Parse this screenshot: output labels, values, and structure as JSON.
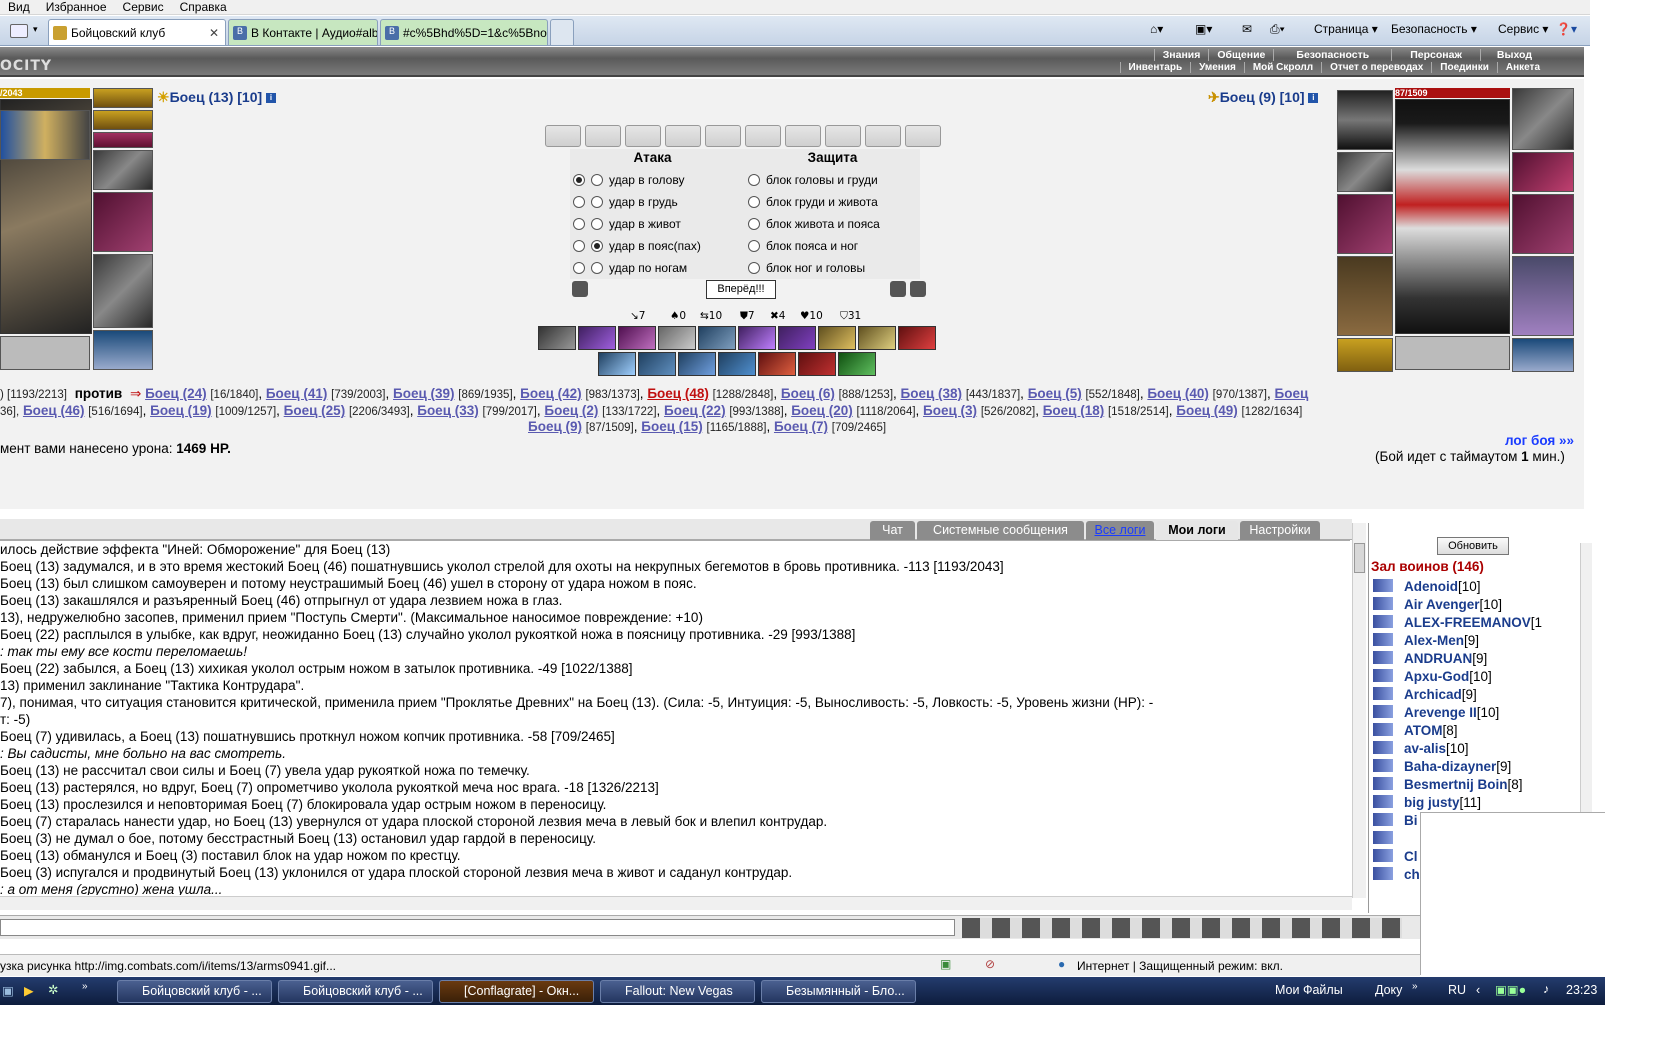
{
  "menubar": {
    "items": [
      "Вид",
      "Избранное",
      "Сервис",
      "Справка"
    ]
  },
  "browser_tabs": [
    {
      "label": "Бойцовский клуб",
      "active": true
    },
    {
      "label": "В Контакте | Аудио#albu...",
      "active": false
    },
    {
      "label": "#c%5Bhd%5D=1&c%5Bno...",
      "active": false
    }
  ],
  "toolbar": {
    "page": "Страница ▾",
    "security": "Безопасность ▾",
    "service": "Сервис ▾"
  },
  "game": {
    "logo": "OCITY",
    "nav_top": [
      "Знания",
      "Общение",
      "Безопасность",
      "Персонаж",
      "Выход"
    ],
    "nav_bottom": [
      "Инвентарь",
      "Умения",
      "Мой Скролл",
      "Отчет о переводах",
      "Поединки",
      "Анкета"
    ]
  },
  "player": {
    "name": "Боец (13) [10]",
    "hp": "/2043"
  },
  "opponent": {
    "name": "Боец (9) [10]",
    "hp": "87/1509"
  },
  "attack": {
    "header": "Атака",
    "options": [
      "удар в голову",
      "удар в грудь",
      "удар в живот",
      "удар в пояс(пах)",
      "удар по ногам"
    ]
  },
  "defense": {
    "header": "Защита",
    "options": [
      "блок головы и груди",
      "блок груди и живота",
      "блок живота и пояса",
      "блок пояса и ног",
      "блок ног и головы"
    ]
  },
  "go_button": "Вперёд!!!",
  "stats": [
    "↘7",
    "♠0",
    "⇆10",
    "⛊7",
    "✖4",
    "♥10",
    "⛉31"
  ],
  "battle": {
    "line1_prefix": ") [1193/2213]",
    "versus": "против",
    "line1": [
      {
        "n": "Боец (24)",
        "v": "[16/1840]"
      },
      {
        "n": "Боец (41)",
        "v": "[739/2003]"
      },
      {
        "n": "Боец (39)",
        "v": "[869/1935]"
      },
      {
        "n": "Боец (42)",
        "v": "[983/1373]"
      },
      {
        "n": "Боец (48)",
        "v": "[1288/2848]"
      },
      {
        "n": "Боец (6)",
        "v": "[888/1253]"
      },
      {
        "n": "Боец (38)",
        "v": "[443/1837]"
      },
      {
        "n": "Боец (5)",
        "v": "[552/1848]"
      },
      {
        "n": "Боец (40)",
        "v": "[970/1387]"
      },
      {
        "n": "Боец",
        "v": ""
      }
    ],
    "line2_prefix": "36],",
    "line2": [
      {
        "n": "Боец (46)",
        "v": "[516/1694]"
      },
      {
        "n": "Боец (19)",
        "v": "[1009/1257]"
      },
      {
        "n": "Боец (25)",
        "v": "[2206/3493]"
      },
      {
        "n": "Боец (33)",
        "v": "[799/2017]"
      },
      {
        "n": "Боец (2)",
        "v": "[133/1722]"
      },
      {
        "n": "Боец (22)",
        "v": "[993/1388]"
      },
      {
        "n": "Боец (20)",
        "v": "[1118/2064]"
      },
      {
        "n": "Боец (3)",
        "v": "[526/2082]"
      },
      {
        "n": "Боец (18)",
        "v": "[1518/2514]"
      },
      {
        "n": "Боец (49)",
        "v": "[1282/1634]"
      }
    ],
    "line3": [
      {
        "n": "Боец (9)",
        "v": "[87/1509]"
      },
      {
        "n": "Боец (15)",
        "v": "[1165/1888]"
      },
      {
        "n": "Боец (7)",
        "v": "[709/2465]"
      }
    ],
    "damage_text": "мент вами нанесено урона:",
    "damage_value": "1469 HP.",
    "log_link": "лог боя »»",
    "timeout": "(Бой идет с таймаутом",
    "timeout_val": "1",
    "timeout_unit": "мин.)"
  },
  "log_tabs": [
    "Чат",
    "Системные сообщения",
    "Все логи",
    "Мои логи",
    "Настройки"
  ],
  "log_lines": [
    "илось действие эффекта \"Иней: Обморожение\" для Боец (13)",
    "Боец (13) задумался, и в это время жестокий Боец (46) пошатнувшись уколол стрелой для охоты на некрупных бегемотов в бровь противника. -113 [1193/2043]",
    "Боец (13) был слишком самоуверен и потому неустрашимый Боец (46) ушел в сторону от удара ножом в пояс.",
    "Боец (13) закашлялся и разъяренный Боец (46) отпрыгнул от удара лезвием ножа в глаз.",
    "13), недружелюбно засопев, применил прием \"Поступь Смерти\". (Максимальное наносимое повреждение: +10)",
    "Боец (22) расплылся в улыбке, как вдруг, неожиданно Боец (13) случайно уколол рукояткой ножа в поясницу противника. -29 [993/1388]",
    ": так ты ему все кости переломаешь!",
    "Боец (22) забылся, а Боец (13) хихикая уколол острым ножом в затылок противника. -49 [1022/1388]",
    "13) применил заклинание \"Тактика Контрудара\".",
    "7), понимая, что ситуация становится критической, применила прием \"Проклятье Древних\" на Боец (13). (Сила: -5, Интуиция: -5, Выносливость: -5, Ловкость: -5, Уровень жизни (НР): -",
    "т: -5)",
    "Боец (7) удивилась, а Боец (13) пошатнувшись проткнул ножом копчик противника. -58 [709/2465]",
    ": Вы садисты, мне больно на вас смотреть.",
    "Боец (13) не рассчитал свои силы и Боец (7) увела удар рукояткой ножа по темечку.",
    "Боец (13) растерялся, но вдруг, Боец (7) опрометчиво уколола рукояткой меча нос врага. -18 [1326/2213]",
    "Боец (13) прослезился и неповторимая Боец (7) блокировала удар острым ножом в переносицу.",
    "Боец (7) старалась нанести удар, но Боец (13) увернулся от удара плоской стороной лезвия меча в левый бок и влепил контрудар.",
    "Боец (3) не думал о бое, потому бесстрастный Боец (13) остановил удар гардой в переносицу.",
    "Боец (13) обманулся и Боец (3) поставил блок на удар ножом по крестцу.",
    "Боец (3) испугался и продвинутый Боец (13) уклонился от удара плоской стороной лезвия меча в живот и саданул контрудар.",
    ": а от меня (грустно) жена ушла..."
  ],
  "roster": {
    "refresh": "Обновить",
    "title": "Зал воинов (146)",
    "players": [
      {
        "name": "Adenoid",
        "lvl": "[10]"
      },
      {
        "name": "Air Avenger",
        "lvl": "[10]"
      },
      {
        "name": "ALEX-FREEMANOV",
        "lvl": "[1"
      },
      {
        "name": "Alex-Men",
        "lvl": "[9]"
      },
      {
        "name": "ANDRUAN",
        "lvl": "[9]"
      },
      {
        "name": "Apxu-God",
        "lvl": "[10]"
      },
      {
        "name": "Archicad",
        "lvl": "[9]"
      },
      {
        "name": "Arevenge II",
        "lvl": "[10]"
      },
      {
        "name": "ATOM",
        "lvl": "[8]"
      },
      {
        "name": "av-alis",
        "lvl": "[10]"
      },
      {
        "name": "Baha-dizayner",
        "lvl": "[9]"
      },
      {
        "name": "Besmertnij Boin",
        "lvl": "[8]"
      },
      {
        "name": "big justy",
        "lvl": "[11]"
      },
      {
        "name": "Bi",
        "lvl": ""
      },
      {
        "name": "",
        "lvl": ""
      },
      {
        "name": "Cl",
        "lvl": ""
      },
      {
        "name": "ch",
        "lvl": ""
      }
    ]
  },
  "status": {
    "loading": "узка рисунка http://img.combats.com/i/items/13/arms0941.gif...",
    "zone": "Интернет | Защищенный режим: вкл."
  },
  "taskbar": {
    "tasks": [
      "Бойцовский клуб - ...",
      "Бойцовский клуб - ...",
      "[Conflagrate] - Окн...",
      "Fallout: New Vegas",
      "Безымянный - Бло..."
    ],
    "my_files": "Мои Файлы",
    "docs": "Доку",
    "lang": "RU",
    "time": "23:23"
  }
}
